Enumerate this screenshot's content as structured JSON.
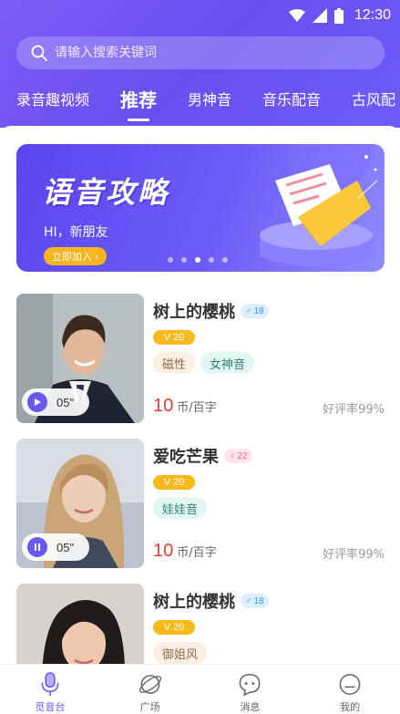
{
  "status": {
    "time": "12:30"
  },
  "search": {
    "placeholder": "请输入搜索关键词"
  },
  "tabs": [
    {
      "label": "录音趣视频"
    },
    {
      "label": "推荐"
    },
    {
      "label": "男神音"
    },
    {
      "label": "音乐配音"
    },
    {
      "label": "古风配"
    }
  ],
  "banner": {
    "title": "语音攻略",
    "subtitle": "HI，新朋友",
    "cta": "立即加入",
    "cta_arrow": "›"
  },
  "items": [
    {
      "name": "树上的樱桃",
      "gender": "♂",
      "age": "18",
      "level_icon": "V",
      "level": "20",
      "tags": [
        "磁性",
        "女神音"
      ],
      "duration": "05\"",
      "price": "10",
      "unit": "币/百字",
      "rating": "好评率99%",
      "playing": false
    },
    {
      "name": "爱吃芒果",
      "gender": "♀",
      "age": "22",
      "level_icon": "V",
      "level": "20",
      "tags": [
        "娃娃音"
      ],
      "duration": "05\"",
      "price": "10",
      "unit": "币/百字",
      "rating": "好评率99%",
      "playing": true
    },
    {
      "name": "树上的樱桃",
      "gender": "♂",
      "age": "18",
      "level_icon": "V",
      "level": "20",
      "tags": [
        "御姐风"
      ]
    }
  ],
  "nav": [
    {
      "label": "觅音台",
      "icon": "microphone-icon"
    },
    {
      "label": "广场",
      "icon": "planet-icon"
    },
    {
      "label": "消息",
      "icon": "chat-bubble-icon"
    },
    {
      "label": "我的",
      "icon": "profile-face-icon"
    }
  ],
  "colors": {
    "accent": "#6b57f2",
    "price": "#e83b3b",
    "level": "#f8b91c"
  }
}
